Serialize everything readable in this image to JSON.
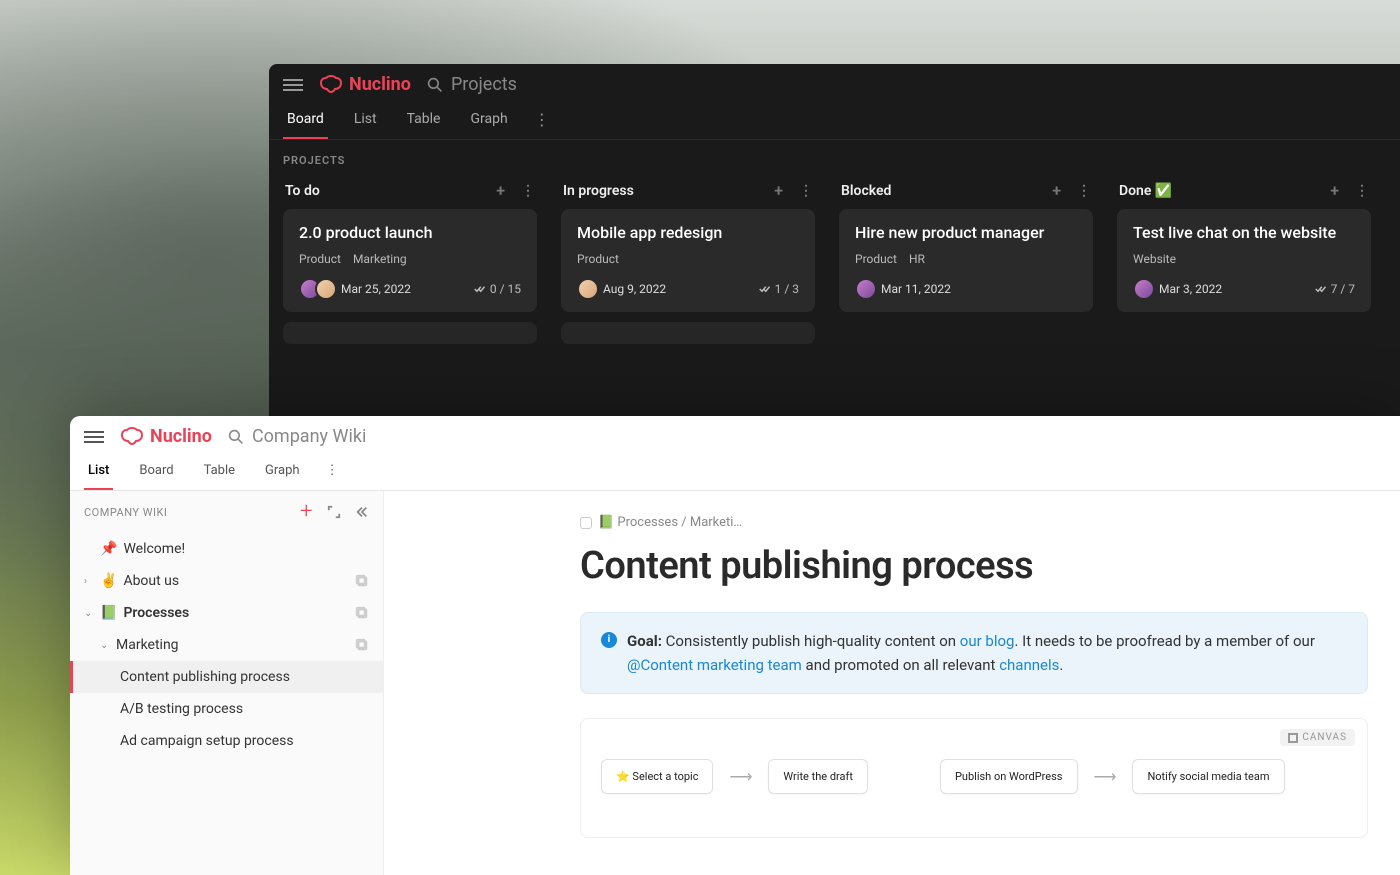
{
  "dark": {
    "app_name": "Nuclino",
    "search_placeholder": "Projects",
    "tabs": [
      "Board",
      "List",
      "Table",
      "Graph"
    ],
    "active_tab": "Board",
    "section_label": "PROJECTS",
    "columns": [
      {
        "title": "To do",
        "card": {
          "title": "2.0 product launch",
          "tags": [
            "Product",
            "Marketing"
          ],
          "date": "Mar 25, 2022",
          "progress": "0 / 15",
          "avatar_count": 2
        }
      },
      {
        "title": "In progress",
        "card": {
          "title": "Mobile app redesign",
          "tags": [
            "Product"
          ],
          "date": "Aug 9, 2022",
          "progress": "1 / 3",
          "avatar_count": 1
        }
      },
      {
        "title": "Blocked",
        "card": {
          "title": "Hire new product manager",
          "tags": [
            "Product",
            "HR"
          ],
          "date": "Mar 11, 2022",
          "progress": "",
          "avatar_count": 1
        }
      },
      {
        "title": "Done ✅",
        "card": {
          "title": "Test live chat on the website",
          "tags": [
            "Website"
          ],
          "date": "Mar 3, 2022",
          "progress": "7 / 7",
          "avatar_count": 1
        }
      }
    ]
  },
  "light": {
    "app_name": "Nuclino",
    "search_placeholder": "Company Wiki",
    "tabs": [
      "List",
      "Board",
      "Table",
      "Graph"
    ],
    "active_tab": "List",
    "sidebar": {
      "label": "COMPANY WIKI",
      "items": [
        {
          "icon": "📌",
          "label": "Welcome!",
          "caret": "",
          "indent": 0
        },
        {
          "icon": "✌️",
          "label": "About us",
          "caret": "›",
          "indent": 0,
          "copy": true
        },
        {
          "icon": "📗",
          "label": "Processes",
          "caret": "⌄",
          "indent": 0,
          "copy": true,
          "bold": true
        },
        {
          "icon": "",
          "label": "Marketing",
          "caret": "⌄",
          "indent": 1,
          "copy": true
        },
        {
          "icon": "",
          "label": "Content publishing process",
          "caret": "",
          "indent": 2,
          "selected": true
        },
        {
          "icon": "",
          "label": "A/B testing process",
          "caret": "",
          "indent": 2
        },
        {
          "icon": "",
          "label": "Ad campaign setup process",
          "caret": "",
          "indent": 2
        }
      ]
    },
    "breadcrumb": "📗 Processes / Marketi…",
    "page_title": "Content publishing process",
    "goal": {
      "label": "Goal:",
      "text_a": "Consistently publish high-quality content on ",
      "link_a": "our blog",
      "text_b": ". It needs to be proofread by a member of our ",
      "link_b": "@Content marketing team",
      "text_c": " and promoted on all relevant ",
      "link_c": "channels",
      "text_d": "."
    },
    "canvas_label": "CANVAS",
    "flow": [
      {
        "label": "⭐ Select a topic"
      },
      {
        "label": "Write the draft"
      },
      {
        "label": "Publish on WordPress"
      },
      {
        "label": "Notify social media team"
      }
    ]
  }
}
